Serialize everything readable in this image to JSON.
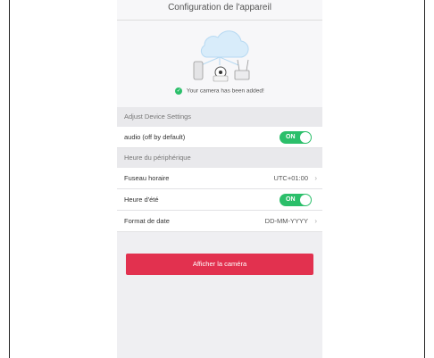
{
  "header": {
    "title": "Configuration de l'appareil"
  },
  "hero": {
    "status_icon": "check-circle-icon",
    "status_text": "Your camera has been added!"
  },
  "sections": {
    "adjust": "Adjust Device Settings",
    "clock": "Heure du périphérique"
  },
  "rows": {
    "audio": {
      "label": "audio (off by default)",
      "toggle": "ON"
    },
    "timezone": {
      "label": "Fuseau horaire",
      "value": "UTC+01:00"
    },
    "dst": {
      "label": "Heure d'été",
      "toggle": "ON"
    },
    "date_format": {
      "label": "Format de date",
      "value": "DD-MM-YYYY"
    }
  },
  "cta": {
    "label": "Afficher la caméra"
  },
  "colors": {
    "accent": "#e2314f",
    "toggle_on": "#2bbf6a"
  }
}
